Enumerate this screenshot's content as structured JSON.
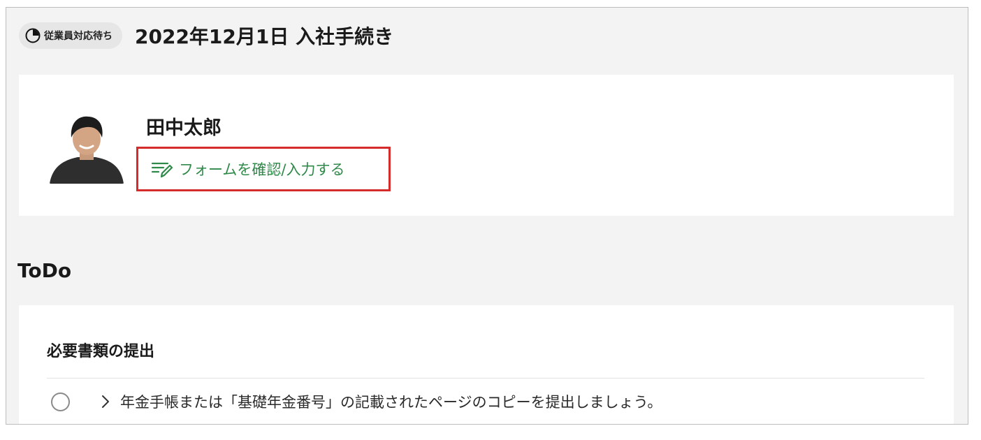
{
  "header": {
    "status_badge": "従業員対応待ち",
    "status_icon": "pie-clock-icon",
    "title": "2022年12月1日 入社手続き"
  },
  "profile": {
    "name": "田中太郎",
    "avatar_icon": "avatar-photo",
    "form_link_icon": "edit-form-icon",
    "form_link_label": "フォームを確認/入力する",
    "highlight_color": "#d62b2b",
    "link_color": "#2f8a4a"
  },
  "todo": {
    "heading": "ToDo",
    "section_title": "必要書類の提出",
    "tasks": [
      {
        "text": "年金手帳または「基礎年金番号」の記載されたページのコピーを提出しましょう。",
        "checkbox_icon": "radio-empty-icon",
        "expand_icon": "chevron-right-icon"
      }
    ]
  }
}
